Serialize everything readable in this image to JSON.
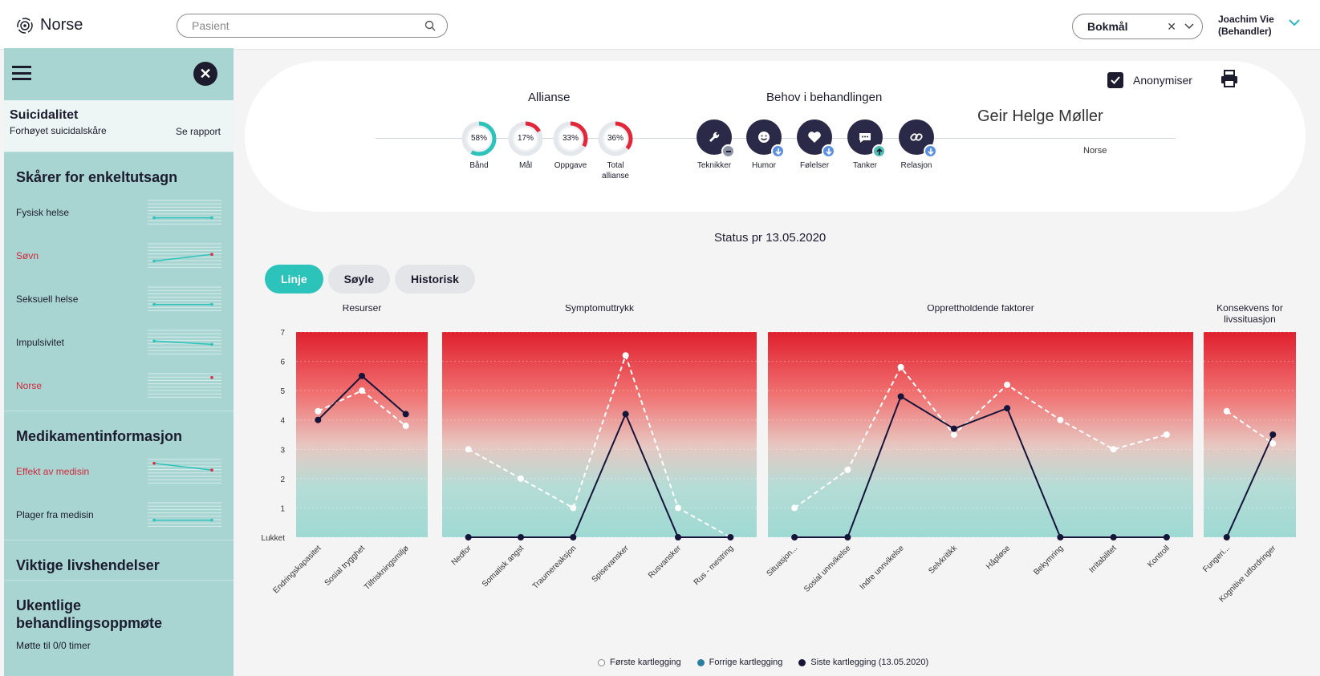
{
  "app": {
    "name": "Norse"
  },
  "search": {
    "placeholder": "Pasient"
  },
  "language": {
    "value": "Bokmål"
  },
  "user": {
    "name": "Joachim Vie",
    "role": "(Behandler)"
  },
  "sidebar": {
    "alert": {
      "title": "Suicidalitet",
      "subtitle": "Forhøyet suicidalskåre",
      "link": "Se rapport"
    },
    "section_scores": "Skårer for enkeltutsagn",
    "score_items": [
      {
        "label": "Fysisk helse",
        "alert": false,
        "spark": [
          2,
          2
        ],
        "end_color": "#2cc3bb"
      },
      {
        "label": "Søvn",
        "alert": true,
        "spark": [
          2,
          4
        ],
        "end_color": "#e2273a"
      },
      {
        "label": "Seksuell helse",
        "alert": false,
        "spark": [
          2,
          2
        ],
        "end_color": "#2cc3bb"
      },
      {
        "label": "Impulsivitet",
        "alert": false,
        "spark": [
          4,
          3
        ],
        "end_color": "#2cc3bb"
      },
      {
        "label": "Norse",
        "alert": true,
        "spark": [
          null,
          6
        ],
        "end_color": "#e2273a"
      }
    ],
    "section_meds": "Medikamentinformasjon",
    "med_items": [
      {
        "label": "Effekt av medisin",
        "alert": true,
        "spark": [
          6,
          4
        ],
        "end_color": "#e2273a"
      },
      {
        "label": "Plager fra medisin",
        "alert": false,
        "spark": [
          2,
          2
        ],
        "end_color": "#2cc3bb"
      }
    ],
    "section_events": "Viktige livshendelser",
    "section_attendance": "Ukentlige behandlingsoppmøte",
    "attendance_text": "Møtte til 0/0 timer"
  },
  "card": {
    "anon_label": "Anonymiser",
    "alliance_title": "Allianse",
    "alliance": [
      {
        "label": "Bånd",
        "value": "58%",
        "pct": 58,
        "color": "#2cc3bb"
      },
      {
        "label": "Mål",
        "value": "17%",
        "pct": 17,
        "color": "#e2273a"
      },
      {
        "label": "Oppgave",
        "value": "33%",
        "pct": 33,
        "color": "#e2273a"
      },
      {
        "label": "Total allianse",
        "value": "36%",
        "pct": 36,
        "color": "#e2273a"
      }
    ],
    "needs_title": "Behov i behandlingen",
    "needs": [
      {
        "label": "Teknikker",
        "icon": "wrench-icon",
        "badge": "minus",
        "badge_color": "#8d94a6"
      },
      {
        "label": "Humor",
        "icon": "smiley-icon",
        "badge": "down",
        "badge_color": "#5b8fe0"
      },
      {
        "label": "Følelser",
        "icon": "heart-icon",
        "badge": "down",
        "badge_color": "#5b8fe0"
      },
      {
        "label": "Tanker",
        "icon": "chat-icon",
        "badge": "up",
        "badge_color": "#4dbfb4"
      },
      {
        "label": "Relasjon",
        "icon": "link-icon",
        "badge": "down",
        "badge_color": "#5b8fe0"
      }
    ],
    "patient_name": "Geir Helge Møller",
    "patient_sub": "Norse"
  },
  "status": "Status pr 13.05.2020",
  "tabs": [
    "Linje",
    "Søyle",
    "Historisk"
  ],
  "active_tab": 0,
  "chart_data": {
    "type": "line",
    "y_ticks": [
      "Lukket",
      "1",
      "2",
      "3",
      "4",
      "5",
      "6",
      "7"
    ],
    "ylim": [
      0,
      7
    ],
    "panels": [
      {
        "title": "Resurser",
        "categories": [
          "Endringskapasitet",
          "Sosial trygghet",
          "Tilfriskningsmiljø"
        ],
        "first": [
          4.3,
          5.0,
          3.8
        ],
        "last": [
          4.0,
          5.5,
          4.2
        ]
      },
      {
        "title": "Symptomuttrykk",
        "categories": [
          "Nedfor",
          "Somatisk angst",
          "Traumereaksjon",
          "Spisevansker",
          "Rusvansker",
          "Rus - mestring"
        ],
        "first": [
          3.0,
          2.0,
          1.0,
          6.2,
          1.0,
          0
        ],
        "last": [
          0,
          0,
          0,
          4.2,
          0,
          0
        ]
      },
      {
        "title": "Opprettholdende faktorer",
        "categories": [
          "Situasjon...",
          "Sosial unnvikelse",
          "Indre unnvikelse",
          "Selvkritikk",
          "Håpløse",
          "Bekymring",
          "Irritabilitet",
          "Kontroll"
        ],
        "first": [
          1.0,
          2.3,
          5.8,
          3.5,
          5.2,
          4.0,
          3.0,
          3.5
        ],
        "last": [
          0,
          0,
          4.8,
          3.7,
          4.4,
          0,
          0,
          0
        ]
      },
      {
        "title": "Konsekvens for livssituasjon",
        "categories": [
          "Fungeri...",
          "Kognitive utfordringer"
        ],
        "first": [
          4.3,
          3.2
        ],
        "last": [
          0,
          3.5
        ]
      }
    ],
    "legend": [
      {
        "name": "Første kartlegging",
        "color": "#ffffff"
      },
      {
        "name": "Forrige kartlegging",
        "color": "#2a7fa0"
      },
      {
        "name": "Siste kartlegging (13.05.2020)",
        "color": "#15153a"
      }
    ]
  }
}
